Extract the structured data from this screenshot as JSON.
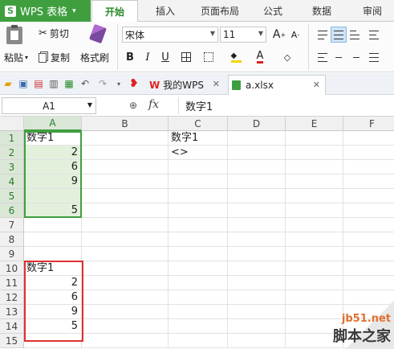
{
  "app": {
    "title": "WPS 表格",
    "logo": "S"
  },
  "ribbon_tabs": [
    "开始",
    "插入",
    "页面布局",
    "公式",
    "数据",
    "审阅"
  ],
  "ribbon": {
    "paste_label": "粘贴",
    "cut_label": "剪切",
    "copy_label": "复制",
    "format_painter_label": "格式刷",
    "font_name": "宋体",
    "font_size": "11",
    "bold": "B",
    "italic": "I",
    "underline": "U",
    "grow_font": "A",
    "shrink_font": "A",
    "font_color": "A"
  },
  "doc_tabs": [
    {
      "label": "我的WPS",
      "active": false
    },
    {
      "label": "a.xlsx",
      "active": true
    }
  ],
  "formula_bar": {
    "name_box": "A1",
    "fx": "fx",
    "content": "数字1"
  },
  "columns": [
    "A",
    "B",
    "C",
    "D",
    "E",
    "F"
  ],
  "rows": [
    "1",
    "2",
    "3",
    "4",
    "5",
    "6",
    "7",
    "8",
    "9",
    "10",
    "11",
    "12",
    "13",
    "14",
    "15"
  ],
  "cells": {
    "A1": "数字1",
    "A2": "2",
    "A3": "6",
    "A4": "9",
    "A5": "",
    "A6": "5",
    "C1": "数字1",
    "C2": "<>",
    "A10": "数字1",
    "A11": "2",
    "A12": "6",
    "A13": "9",
    "A14": "5"
  },
  "watermark": {
    "site": "jb51.net",
    "brand": "脚本之家"
  },
  "colors": {
    "accent": "#3f9f3f",
    "selection_fill": "#e3f1dc",
    "highlight_box": "#e03030"
  }
}
